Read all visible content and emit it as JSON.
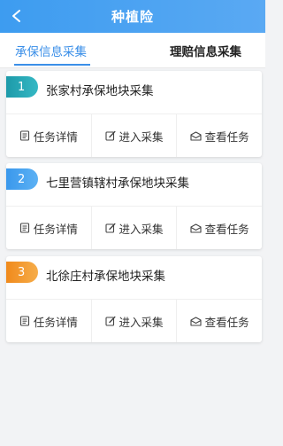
{
  "header": {
    "title": "种植险",
    "back_icon": "chevron-left-icon"
  },
  "tabs": [
    {
      "label": "承保信息采集",
      "active": true
    },
    {
      "label": "理赔信息采集",
      "active": false
    }
  ],
  "colors": {
    "accent": "#3b8fe8",
    "badge_1": "#2aa8b6",
    "badge_2": "#4aa3ee",
    "badge_3": "#f29a2e"
  },
  "cards": [
    {
      "number": "1",
      "title": "张家村承保地块采集",
      "actions": [
        {
          "label": "任务详情",
          "icon": "document-icon"
        },
        {
          "label": "进入采集",
          "icon": "edit-icon"
        },
        {
          "label": "查看任务",
          "icon": "envelope-icon"
        }
      ]
    },
    {
      "number": "2",
      "title": "七里营镇辖村承保地块采集",
      "actions": [
        {
          "label": "任务详情",
          "icon": "document-icon"
        },
        {
          "label": "进入采集",
          "icon": "edit-icon"
        },
        {
          "label": "查看任务",
          "icon": "envelope-icon"
        }
      ]
    },
    {
      "number": "3",
      "title": "北徐庄村承保地块采集",
      "actions": [
        {
          "label": "任务详情",
          "icon": "document-icon"
        },
        {
          "label": "进入采集",
          "icon": "edit-icon"
        },
        {
          "label": "查看任务",
          "icon": "envelope-icon"
        }
      ]
    }
  ]
}
